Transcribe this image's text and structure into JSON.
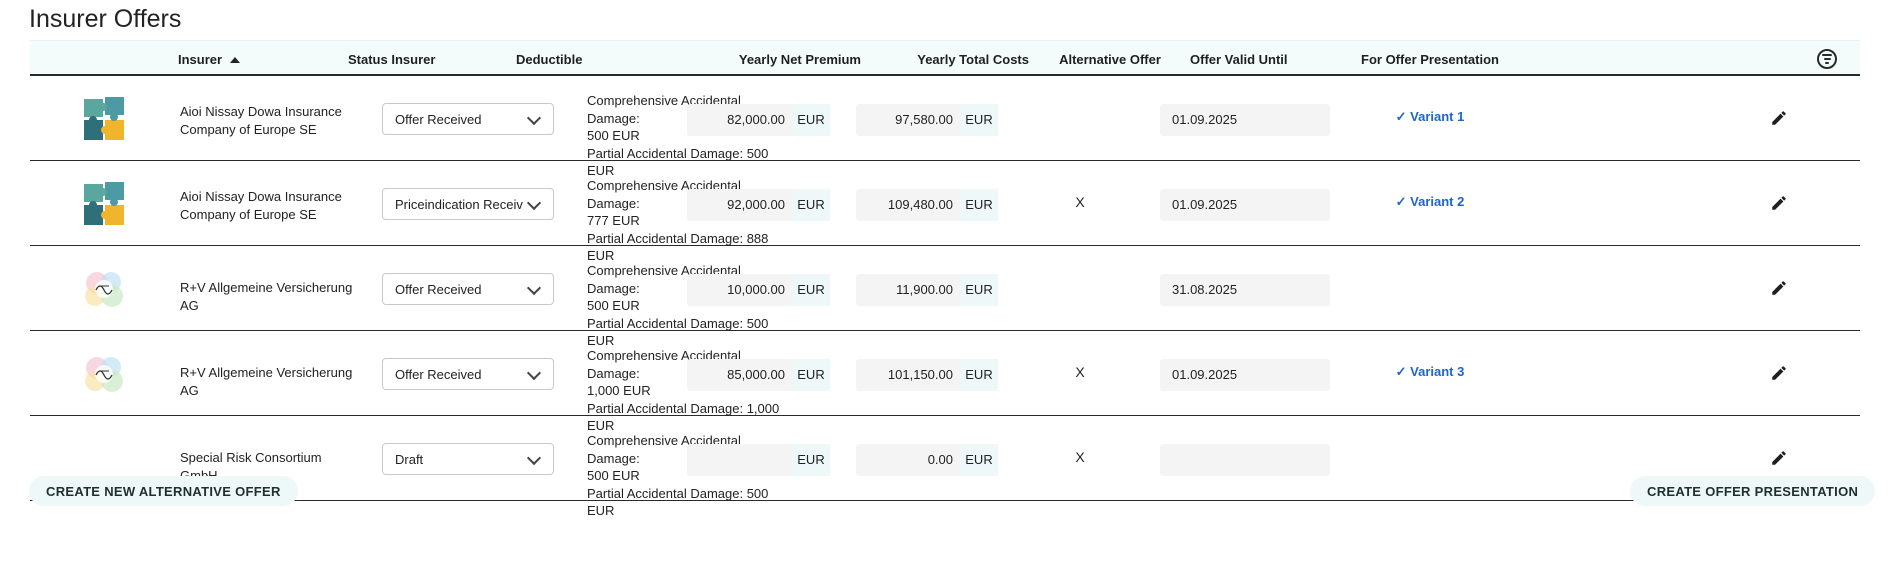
{
  "page": {
    "title": "Insurer Offers"
  },
  "columns": {
    "insurer": "Insurer",
    "status": "Status Insurer",
    "deductible": "Deductible",
    "net_premium": "Yearly Net Premium",
    "total_costs": "Yearly Total Costs",
    "alternative": "Alternative Offer",
    "valid_until": "Offer Valid Until",
    "presentation": "For Offer Presentation"
  },
  "sort": {
    "column": "insurer",
    "direction": "ascending"
  },
  "icons": {
    "sort": "sort-ascending-icon",
    "filter": "filter-icon",
    "edit": "pencil-icon",
    "select": "chevron-down-icon"
  },
  "colors": {
    "accent_bg": "#eef8f8",
    "variant_link": "#1e66c8",
    "field_bg": "#f4f4f4"
  },
  "rows": [
    {
      "insurer": "Aioi Nissay Dowa Insurance Company of Europe SE",
      "logo": "puzzle-logo",
      "status": "Offer Received",
      "deductible": [
        "Comprehensive Accidental Damage:",
        "500 EUR",
        "Partial Accidental Damage: 500 EUR"
      ],
      "net_premium": "82,000.00",
      "net_currency": "EUR",
      "total_costs": "97,580.00",
      "total_currency": "EUR",
      "alternative": "",
      "valid_until": "01.09.2025",
      "presentation": "✓ Variant 1"
    },
    {
      "insurer": "Aioi Nissay Dowa Insurance Company of Europe SE",
      "logo": "puzzle-logo",
      "status": "Priceindication Received",
      "deductible": [
        "Comprehensive Accidental Damage:",
        "777 EUR",
        "Partial Accidental Damage: 888 EUR"
      ],
      "net_premium": "92,000.00",
      "net_currency": "EUR",
      "total_costs": "109,480.00",
      "total_currency": "EUR",
      "alternative": "X",
      "valid_until": "01.09.2025",
      "presentation": "✓ Variant 2"
    },
    {
      "insurer": "R+V Allgemeine Versicherung AG",
      "logo": "watercolor-logo",
      "status": "Offer Received",
      "deductible": [
        "Comprehensive Accidental Damage:",
        "500 EUR",
        "Partial Accidental Damage: 500 EUR"
      ],
      "net_premium": "10,000.00",
      "net_currency": "EUR",
      "total_costs": "11,900.00",
      "total_currency": "EUR",
      "alternative": "",
      "valid_until": "31.08.2025",
      "presentation": ""
    },
    {
      "insurer": "R+V Allgemeine Versicherung AG",
      "logo": "watercolor-logo",
      "status": "Offer Received",
      "deductible": [
        "Comprehensive Accidental Damage:",
        "1,000 EUR",
        "Partial Accidental Damage: 1,000 EUR"
      ],
      "net_premium": "85,000.00",
      "net_currency": "EUR",
      "total_costs": "101,150.00",
      "total_currency": "EUR",
      "alternative": "X",
      "valid_until": "01.09.2025",
      "presentation": "✓ Variant 3"
    },
    {
      "insurer": "Special Risk Consortium GmbH",
      "logo": "",
      "status": "Draft",
      "deductible": [
        "Comprehensive Accidental Damage:",
        "500 EUR",
        "Partial Accidental Damage: 500 EUR"
      ],
      "net_premium": "",
      "net_currency": "EUR",
      "total_costs": "0.00",
      "total_currency": "EUR",
      "alternative": "X",
      "valid_until": "",
      "presentation": ""
    }
  ],
  "actions": {
    "create_alternative": "CREATE NEW ALTERNATIVE OFFER",
    "create_presentation": "CREATE OFFER PRESENTATION"
  }
}
